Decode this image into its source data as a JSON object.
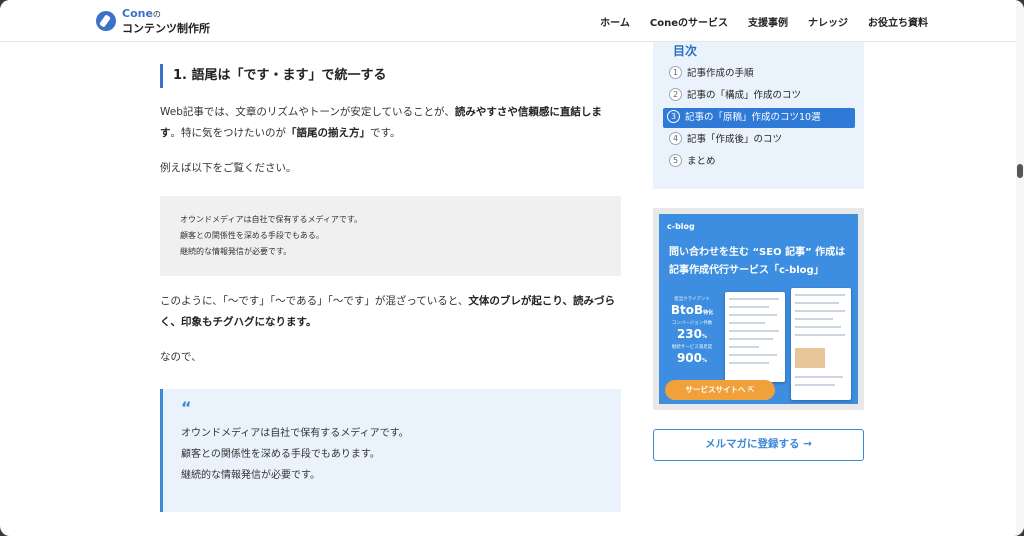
{
  "header": {
    "logo_line1": "Cone",
    "logo_small": "の",
    "logo_line2": "コンテンツ制作所",
    "nav": [
      "ホーム",
      "Coneのサービス",
      "支援事例",
      "ナレッジ",
      "お役立ち資料"
    ]
  },
  "article": {
    "heading": "1. 語尾は「です・ます」で統一する",
    "p1_a": "Web記事では、文章のリズムやトーンが安定していることが、",
    "p1_b": "読みやすさや信頼感に直結します",
    "p1_c": "。特に気をつけたいのが",
    "p1_d": "「語尾の揃え方」",
    "p1_e": "です。",
    "p2": "例えば以下をご覧ください。",
    "gray_lines": [
      "オウンドメディアは自社で保有するメディアです。",
      "顧客との関係性を深める手段でもある。",
      "継続的な情報発信が必要です。"
    ],
    "p3_a": "このように、「〜です」「〜である」「〜です」が混ざっていると、",
    "p3_b": "文体のブレが起こり、読みづらく、印象もチグハグになります。",
    "p4": "なので、",
    "quote_mark": "“",
    "quote_lines": [
      "オウンドメディアは自社で保有するメディアです。",
      "顧客との関係性を深める手段でもあります。",
      "継続的な情報発信が必要です。"
    ]
  },
  "toc": {
    "title": "目次",
    "items": [
      {
        "num": "1",
        "label": "記事作成の手順"
      },
      {
        "num": "2",
        "label": "記事の「構成」作成のコツ"
      },
      {
        "num": "3",
        "label": "記事の「原稿」作成のコツ10選"
      },
      {
        "num": "4",
        "label": "記事「作成後」のコツ"
      },
      {
        "num": "5",
        "label": "まとめ"
      }
    ],
    "active_index": 2,
    "active_color": "#2f7ad7"
  },
  "banner": {
    "logo": "c-blog",
    "title_line1": "問い合わせを生む “SEO 記事” 作成は",
    "title_line2": "記事作成代行サービス「c-blog」",
    "stats": [
      {
        "label": "担当クライアント",
        "value": "BtoB",
        "unit": "特化"
      },
      {
        "label": "コンバージョン件数",
        "value": "230",
        "unit": "%"
      },
      {
        "label": "継続サービス満足度",
        "value": "900",
        "unit": "%"
      }
    ],
    "button": "サービスサイトへ"
  },
  "mail_button": "メルマガに登録する →",
  "colors": {
    "accent": "#3b72c9",
    "quote_bg": "#eaf3fb",
    "cta": "#f1a13b"
  }
}
